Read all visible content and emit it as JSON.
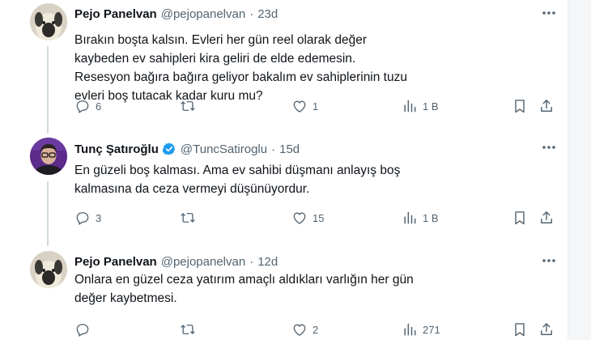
{
  "tweets": [
    {
      "name": "Pejo Panelvan",
      "handle": "@pejopanelvan",
      "separator": "·",
      "time": "23d",
      "text": "Bırakın boşta kalsın. Evleri her gün reel olarak değer kaybeden ev sahipleri kira geliri de elde edemesin. Resesyon bağıra bağıra geliyor bakalım ev sahiplerinin tuzu evleri boş tutacak kadar kuru mu?",
      "replies": "6",
      "retweets": "",
      "likes": "1",
      "views": "1 B"
    },
    {
      "name": "Tunç Şatıroğlu",
      "handle": "@TuncSatiroglu",
      "separator": "·",
      "time": "15d",
      "verified": true,
      "text": "En güzeli boş kalması. Ama ev sahibi düşmanı anlayış boş kalmasına da ceza vermeyi düşünüyordur.",
      "replies": "3",
      "retweets": "",
      "likes": "15",
      "views": "1 B"
    },
    {
      "name": "Pejo Panelvan",
      "handle": "@pejopanelvan",
      "separator": "·",
      "time": "12d",
      "text": "Onlara en güzel ceza yatırım amaçlı aldıkları varlığın her gün değer kaybetmesi.",
      "replies": "",
      "retweets": "",
      "likes": "2",
      "views": "271"
    }
  ],
  "colors": {
    "text": "#0f1419",
    "muted": "#536471",
    "verified": "#1d9bf0",
    "thread_line": "#cfd9de"
  },
  "icons": [
    "reply-icon",
    "retweet-icon",
    "like-icon",
    "views-icon",
    "bookmark-icon",
    "share-icon",
    "more-icon",
    "verified-badge-icon"
  ]
}
